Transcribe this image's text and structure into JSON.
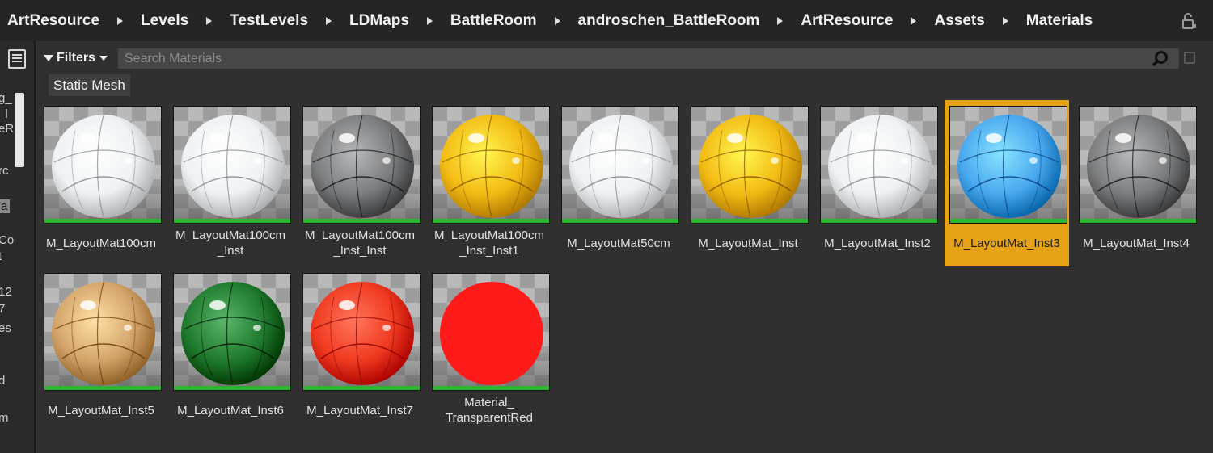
{
  "breadcrumb": [
    "ArtResource",
    "Levels",
    "TestLevels",
    "LDMaps",
    "BattleRoom",
    "androschen_BattleRoom",
    "ArtResource",
    "Assets",
    "Materials"
  ],
  "left_strip": [
    "g_",
    "_l",
    "eR",
    "rc",
    "a",
    "Co",
    "t",
    "12",
    "7",
    "es",
    "d",
    "m"
  ],
  "filters_label": "Filters",
  "search": {
    "placeholder": "Search Materials",
    "value": ""
  },
  "active_filter": "Static Mesh",
  "colors": {
    "selection": "#e6a318",
    "asset_bar": "#2db52d"
  },
  "assets": [
    {
      "name": "M_LayoutMat100cm",
      "color": "#eef2f4",
      "selected": false
    },
    {
      "name": "M_LayoutMat100cm\n_Inst",
      "color": "#eef2f4",
      "selected": false
    },
    {
      "name": "M_LayoutMat100cm\n_Inst_Inst",
      "color": "#7a7c7e",
      "selected": false
    },
    {
      "name": "M_LayoutMat100cm\n_Inst_Inst1",
      "color": "#f2bb14",
      "selected": false
    },
    {
      "name": "M_LayoutMat50cm",
      "color": "#eef2f4",
      "selected": false
    },
    {
      "name": "M_LayoutMat_Inst",
      "color": "#f2bb14",
      "selected": false
    },
    {
      "name": "M_LayoutMat_Inst2",
      "color": "#eef2f4",
      "selected": false
    },
    {
      "name": "M_LayoutMat_Inst3",
      "color": "#4aa8ee",
      "selected": true
    },
    {
      "name": "M_LayoutMat_Inst4",
      "color": "#7a7c7e",
      "selected": false
    },
    {
      "name": "M_LayoutMat_Inst5",
      "color": "#d3a46a",
      "selected": false
    },
    {
      "name": "M_LayoutMat_Inst6",
      "color": "#1f7a2e",
      "selected": false
    },
    {
      "name": "M_LayoutMat_Inst7",
      "color": "#f03a20",
      "selected": false
    },
    {
      "name": "Material_\nTransparentRed",
      "color": "#ff1a1a",
      "selected": false,
      "flat": true
    }
  ]
}
